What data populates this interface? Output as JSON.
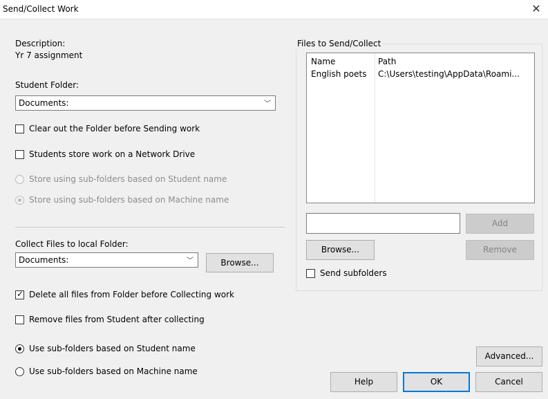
{
  "window": {
    "title": "Send/Collect Work"
  },
  "description": {
    "label": "Description:",
    "value": "Yr 7 assignment"
  },
  "student_folder": {
    "label": "Student Folder:",
    "selected": "Documents:",
    "clear_folder_label": "Clear out the Folder before Sending work",
    "clear_folder_checked": false,
    "network_drive_label": "Students store work on a Network Drive",
    "network_drive_checked": false,
    "subfolder_student_label": "Store using sub-folders based on Student name",
    "subfolder_machine_label": "Store using sub-folders based on Machine name",
    "subfolder_selected": "machine"
  },
  "collect": {
    "label": "Collect Files to local Folder:",
    "selected": "Documents:",
    "browse_label": "Browse...",
    "delete_files_label": "Delete all files from Folder before Collecting work",
    "delete_files_checked": true,
    "remove_files_label": "Remove files from Student after collecting",
    "remove_files_checked": false,
    "use_student_label": "Use sub-folders based on Student name",
    "use_machine_label": "Use sub-folders based on Machine name",
    "subfolder_selected": "student"
  },
  "files": {
    "group_label": "Files to Send/Collect",
    "columns": [
      "Name",
      "Path"
    ],
    "rows": [
      {
        "name": "English poets",
        "path": "C:\\Users\\testing\\AppData\\Roami..."
      }
    ],
    "new_file_value": "",
    "add_label": "Add",
    "browse_label": "Browse...",
    "remove_label": "Remove",
    "send_subfolders_label": "Send subfolders",
    "send_subfolders_checked": false
  },
  "buttons": {
    "advanced": "Advanced...",
    "help": "Help",
    "ok": "OK",
    "cancel": "Cancel"
  },
  "icons": {
    "close": "close-icon",
    "dropdown": "chevron-down-icon",
    "check": "checkmark-icon"
  },
  "colors": {
    "accent": "#0078d7",
    "background": "#f0f0f0"
  }
}
